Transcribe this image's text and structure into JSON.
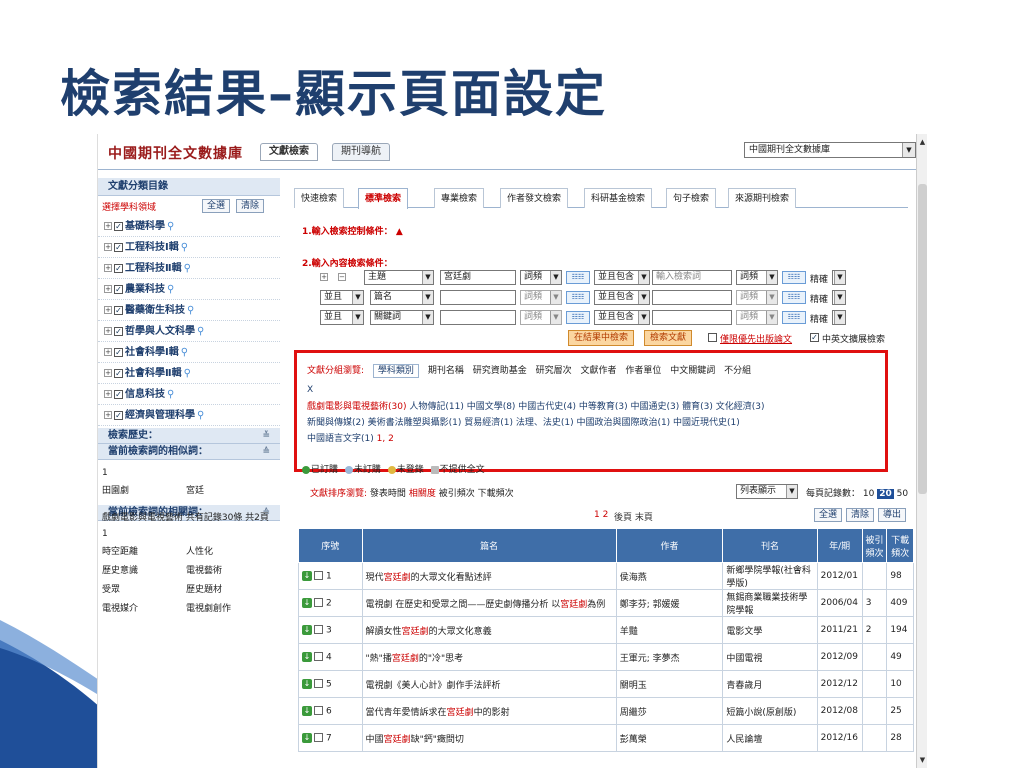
{
  "slide_title": "檢索結果–顯示頁面設定",
  "app": {
    "brand": "中國期刊全文數據庫",
    "top_tabs": [
      "文獻檢索",
      "期刊導航"
    ],
    "db_select": "中國期刊全文數據庫"
  },
  "sidebar": {
    "head": "文獻分類目錄",
    "select_label": "選擇學科領域",
    "select_all": "全選",
    "clear": "清除",
    "categories": [
      "基礎科學",
      "工程科技Ⅰ輯",
      "工程科技Ⅱ輯",
      "農業科技",
      "醫藥衛生科技",
      "哲學與人文科學",
      "社會科學Ⅰ輯",
      "社會科學Ⅱ輯",
      "信息科技",
      "經濟與管理科學"
    ],
    "history_head": "檢索歷史：",
    "similar_head": "當前檢索詞的相似詞：",
    "similar_count": "1",
    "similar_pair": [
      "田園劇",
      "宮廷"
    ],
    "related_head": "當前檢索詞的相關詞：",
    "related_count": "1",
    "related_pairs": [
      [
        "時空距離",
        "人性化"
      ],
      [
        "歷史意識",
        "電視藝術"
      ],
      [
        "受眾",
        "歷史題材"
      ],
      [
        "電視媒介",
        "電視劇創作"
      ]
    ]
  },
  "search": {
    "tabs": [
      "快速檢索",
      "標準檢索",
      "專業檢索",
      "作者發文檢索",
      "科研基金檢索",
      "句子檢索",
      "來源期刊檢索"
    ],
    "section1": "1.輸入檢索控制條件：",
    "section2": "2.輸入內容檢索條件：",
    "row1": {
      "field": "主題",
      "value": "宮廷劇",
      "freq": "詞頻",
      "logic": "並且包含",
      "placeholder": "輸入檢索詞",
      "freq2": "詞頻",
      "match": "精確"
    },
    "row2": {
      "op": "並且",
      "field": "篇名",
      "freq": "詞頻",
      "logic": "並且包含",
      "freq2": "詞頻",
      "match": "精確"
    },
    "row3": {
      "op": "並且",
      "field": "關鍵詞",
      "freq": "詞頻",
      "logic": "並且包含",
      "freq2": "詞頻",
      "match": "精確"
    },
    "btn_within": "在結果中檢索",
    "btn_search": "檢索文獻",
    "opt_first": "僅限優先出版論文",
    "opt_expand": "中英文擴展檢索"
  },
  "classify": {
    "label": "文獻分組瀏覽:",
    "tabs": [
      "學科類別",
      "期刊名稱",
      "研究資助基金",
      "研究層次",
      "文獻作者",
      "作者單位",
      "中文關鍵詞",
      "不分組"
    ],
    "close": "X",
    "line1_red": "戲劇電影與電視藝術(30)",
    "line1_rest": "人物傳記(11)  中國文學(8)  中國古代史(4)  中等教育(3)  中國通史(3)  體育(3)  文化經濟(3)",
    "line2": "新聞與傳媒(2)  美術書法雕塑與攝影(1)  貿易經濟(1)  法理、法史(1)  中國政治與國際政治(1)  中國近現代史(1)",
    "line3": "中國語言文字(1)",
    "line3_pages": "1, 2"
  },
  "legend": [
    "已訂購",
    "未訂購",
    "未登錄",
    "不提供全文"
  ],
  "sort": {
    "label": "文獻排序瀏覽:",
    "opts": [
      "發表時間",
      "相關度",
      "被引頻次",
      "下載頻次"
    ],
    "active": "相關度"
  },
  "list_view": "列表顯示",
  "per_page": {
    "label": "每頁記錄數：",
    "opts": [
      "10",
      "20",
      "50"
    ],
    "current": "20"
  },
  "result_info": "戲劇電影與電視藝術 共有記錄30條 共2頁",
  "pager": "1 2",
  "pager_next": "後頁 末頁",
  "actions": [
    "全選",
    "清除",
    "導出"
  ],
  "table": {
    "headers": [
      "序號",
      "篇名",
      "作者",
      "刊名",
      "年/期",
      "被引頻次",
      "下載頻次"
    ],
    "rows": [
      {
        "n": "1",
        "pre": "現代",
        "hl": "宮廷劇",
        "post": "的大眾文化看點述評",
        "author": "侯海燕",
        "journal": "新鄉學院學報(社會科學版)",
        "year": "2012/01",
        "cite": "",
        "dl": "98"
      },
      {
        "n": "2",
        "pre": "電視劇 在歷史和受眾之間——歷史劇傳播分析 以",
        "hl": "宮廷劇",
        "post": "為例",
        "author": "鄭李芬; 郭媛媛",
        "journal": "無錫商業職業技術學院學報",
        "year": "2006/04",
        "cite": "3",
        "dl": "409"
      },
      {
        "n": "3",
        "pre": "解讀女性",
        "hl": "宮廷劇",
        "post": "的大眾文化意義",
        "author": "羊豔",
        "journal": "電影文學",
        "year": "2011/21",
        "cite": "2",
        "dl": "194"
      },
      {
        "n": "4",
        "pre": "\"熱\"播",
        "hl": "宮廷劇",
        "post": "的\"冷\"思考",
        "author": "王軍元; 李夢杰",
        "journal": "中國電視",
        "year": "2012/09",
        "cite": "",
        "dl": "49"
      },
      {
        "n": "5",
        "pre": "電視劇《美人心計》劇作手法評析",
        "hl": "",
        "post": "",
        "author": "關明玉",
        "journal": "青春歲月",
        "year": "2012/12",
        "cite": "",
        "dl": "10"
      },
      {
        "n": "6",
        "pre": "當代青年愛情訴求在",
        "hl": "宮廷劇",
        "post": "中的影射",
        "author": "周繼莎",
        "journal": "短篇小說(原創版)",
        "year": "2012/08",
        "cite": "",
        "dl": "25"
      },
      {
        "n": "7",
        "pre": "中國",
        "hl": "宮廷劇",
        "post": "缺\"鈣\"癥問切",
        "author": "彭萬榮",
        "journal": "人民論壇",
        "year": "2012/16",
        "cite": "",
        "dl": "28"
      }
    ]
  },
  "colors": {
    "title": "#1f3f6e",
    "brand": "#9a1b1b",
    "highlight_box": "#e01010",
    "table_header": "#3f6ea8"
  }
}
